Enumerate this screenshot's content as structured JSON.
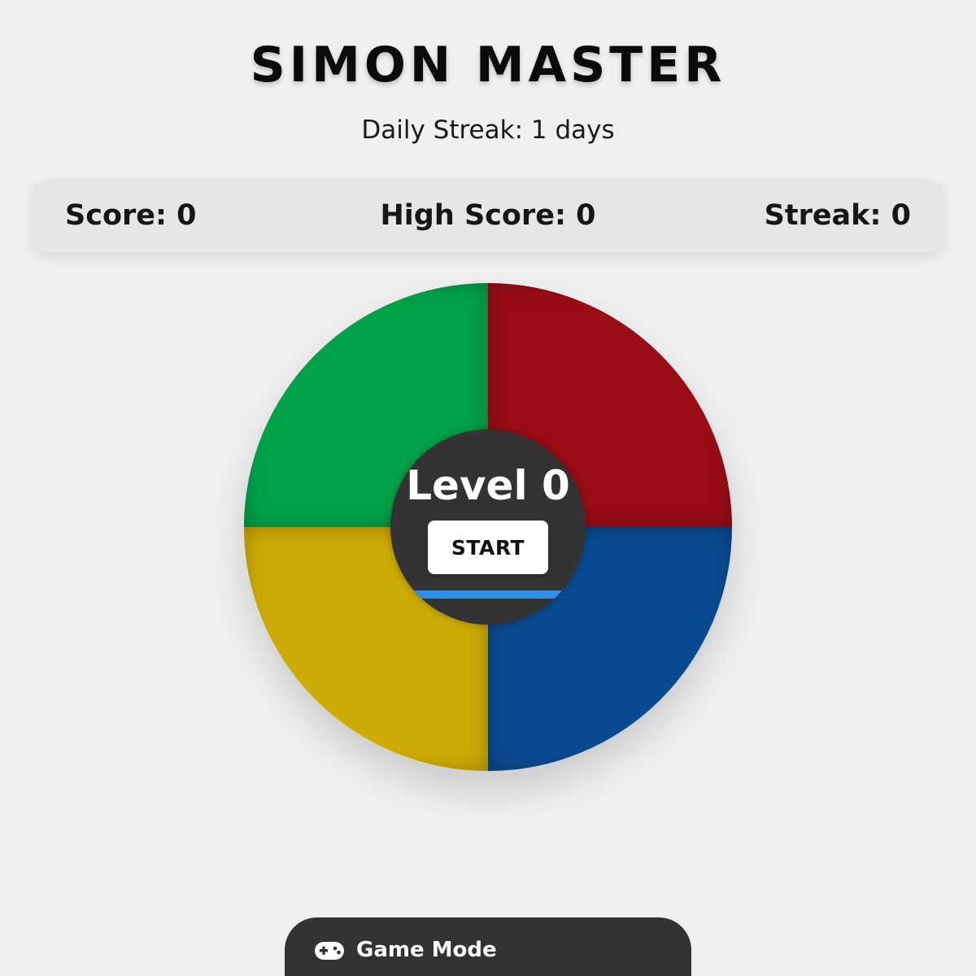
{
  "header": {
    "title": "SIMON MASTER",
    "daily_streak": "Daily Streak: 1 days"
  },
  "stats": {
    "score": "Score: 0",
    "high_score": "High Score: 0",
    "streak": "Streak: 0"
  },
  "board": {
    "pads": [
      {
        "id": "green",
        "color": "#00a24a"
      },
      {
        "id": "red",
        "color": "#9a0d17"
      },
      {
        "id": "yellow",
        "color": "#ccab06"
      },
      {
        "id": "blue",
        "color": "#0a4a90"
      }
    ],
    "center": {
      "level_label": "Level 0",
      "start_label": "START",
      "progress_color": "#2f8fe6"
    }
  },
  "footer": {
    "mode_label": "Game Mode",
    "mode_icon": "gamepad-icon"
  }
}
